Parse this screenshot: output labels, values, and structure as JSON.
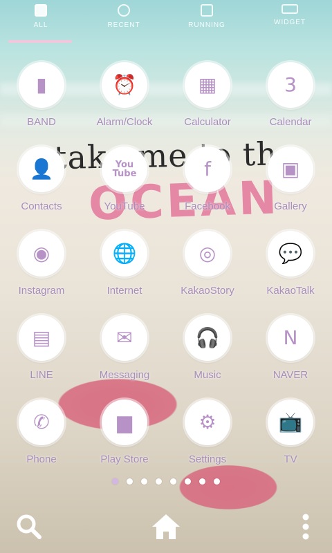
{
  "tabs": [
    {
      "label": "ALL",
      "icon": "grid-icon"
    },
    {
      "label": "RECENT",
      "icon": "clock-icon"
    },
    {
      "label": "RUNNING",
      "icon": "checklist-icon"
    },
    {
      "label": "WIDGET",
      "icon": "widget-icon"
    }
  ],
  "background": {
    "line1": "take me to the",
    "line2": "OCEAN"
  },
  "apps": [
    {
      "label": "BAND",
      "glyph": "▮",
      "icon": "band-icon"
    },
    {
      "label": "Alarm/Clock",
      "glyph": "⏰",
      "icon": "alarm-clock-icon"
    },
    {
      "label": "Calculator",
      "glyph": "▦",
      "icon": "calculator-icon"
    },
    {
      "label": "Calendar",
      "glyph": "3",
      "icon": "calendar-icon"
    },
    {
      "label": "Contacts",
      "glyph": "👤",
      "icon": "contacts-icon"
    },
    {
      "label": "YouTube",
      "glyph": "You\nTube",
      "icon": "youtube-icon"
    },
    {
      "label": "Facebook",
      "glyph": "f",
      "icon": "facebook-icon"
    },
    {
      "label": "Gallery",
      "glyph": "▣",
      "icon": "gallery-icon"
    },
    {
      "label": "Instagram",
      "glyph": "◉",
      "icon": "instagram-icon"
    },
    {
      "label": "Internet",
      "glyph": "🌐",
      "icon": "globe-icon"
    },
    {
      "label": "KakaoStory",
      "glyph": "◎",
      "icon": "kakaostory-icon"
    },
    {
      "label": "KakaoTalk",
      "glyph": "💬",
      "icon": "kakaotalk-icon"
    },
    {
      "label": "LINE",
      "glyph": "▤",
      "icon": "line-icon"
    },
    {
      "label": "Messaging",
      "glyph": "✉",
      "icon": "envelope-icon"
    },
    {
      "label": "Music",
      "glyph": "🎧",
      "icon": "headphones-icon"
    },
    {
      "label": "NAVER",
      "glyph": "N",
      "icon": "naver-icon"
    },
    {
      "label": "Phone",
      "glyph": "✆",
      "icon": "phone-icon"
    },
    {
      "label": "Play Store",
      "glyph": "▆",
      "icon": "briefcase-icon"
    },
    {
      "label": "Settings",
      "glyph": "⚙",
      "icon": "gear-icon"
    },
    {
      "label": "TV",
      "glyph": "📺",
      "icon": "tv-icon"
    }
  ],
  "pager": {
    "total": 8,
    "active_index": 0
  },
  "dock": {
    "search": "search-icon",
    "home": "home-icon",
    "menu": "more-vertical-icon"
  },
  "colors": {
    "accent": "#b792c6",
    "label": "#a98cba",
    "indicator": "#f3c6dc"
  }
}
